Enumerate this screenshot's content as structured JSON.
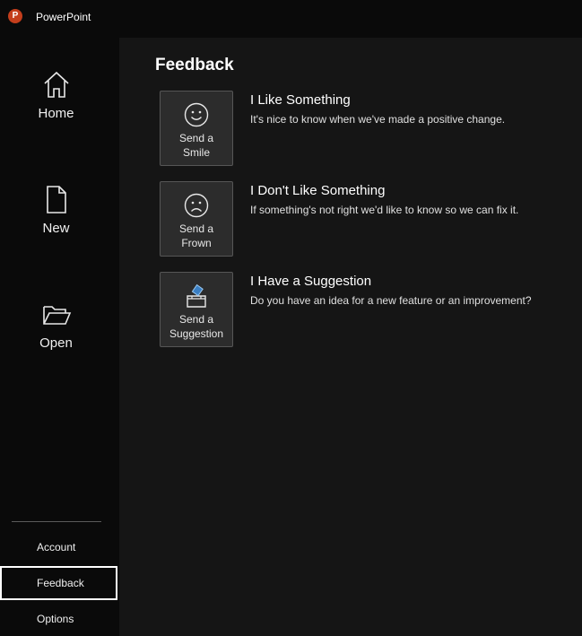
{
  "app": {
    "title": "PowerPoint",
    "logo_letter": "P",
    "brand_color": "#c43e1c"
  },
  "sidebar": {
    "home_label": "Home",
    "new_label": "New",
    "open_label": "Open",
    "account_label": "Account",
    "feedback_label": "Feedback",
    "options_label": "Options",
    "selected": "Feedback"
  },
  "main": {
    "title": "Feedback",
    "items": [
      {
        "button_line1": "Send a",
        "button_line2": "Smile",
        "icon": "smile-icon",
        "heading": "I Like Something",
        "description": "It's nice to know when we've made a positive change."
      },
      {
        "button_line1": "Send a",
        "button_line2": "Frown",
        "icon": "frown-icon",
        "heading": "I Don't Like Something",
        "description": "If something's not right we'd like to know so we can fix it."
      },
      {
        "button_line1": "Send a",
        "button_line2": "Suggestion",
        "icon": "suggestion-box-icon",
        "heading": "I Have a Suggestion",
        "description": "Do you have an idea for a new feature or an improvement?"
      }
    ]
  }
}
